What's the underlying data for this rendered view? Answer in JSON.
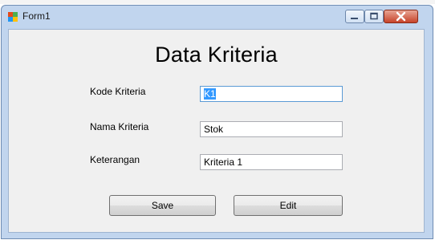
{
  "window": {
    "title": "Form1",
    "controls": {
      "minimize_icon": "minimize-icon",
      "maximize_icon": "maximize-icon",
      "close_icon": "close-icon"
    }
  },
  "form": {
    "heading": "Data Kriteria",
    "fields": [
      {
        "label": "Kode Kriteria",
        "value": "K1",
        "selected": true
      },
      {
        "label": "Nama Kriteria",
        "value": "Stok"
      },
      {
        "label": "Keterangan",
        "value": "Kriteria 1"
      }
    ],
    "buttons": {
      "save": "Save",
      "edit": "Edit"
    }
  },
  "colors": {
    "window_frame": "#c1d5ee",
    "client_bg": "#f0f0f0",
    "close_button": "#c7442a",
    "selection": "#3399ff"
  }
}
